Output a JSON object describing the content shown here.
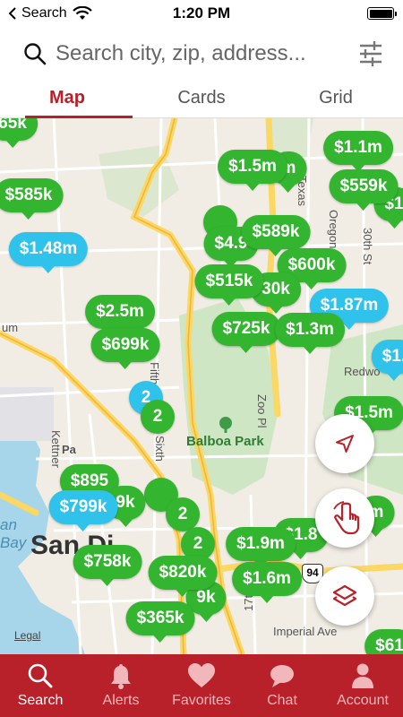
{
  "status_bar": {
    "back_app": "Search",
    "time": "1:20 PM"
  },
  "search": {
    "placeholder": "Search city, zip, address..."
  },
  "tabs": [
    {
      "label": "Map",
      "active": true
    },
    {
      "label": "Cards",
      "active": false
    },
    {
      "label": "Grid",
      "active": false
    }
  ],
  "map": {
    "labels": {
      "park": "Balboa Park",
      "imperial": "Imperial Ave",
      "kettner": "Kettner",
      "fifth": "Fifth",
      "sixth": "Sixth",
      "zoo": "Zoo Pl",
      "oregon": "Oregon",
      "thirtieth": "30th St",
      "texas": "Texas",
      "redwood": "Redwo",
      "seventeenth": "17th",
      "um": "um",
      "pa": "Pa",
      "sd": "San Di",
      "an": "an",
      "bay": "Bay",
      "highway": "94"
    },
    "legal": "Legal",
    "pins": [
      {
        "label": "65k",
        "color": "green"
      },
      {
        "label": "$1.1m",
        "color": "green"
      },
      {
        "label": "$1.5m",
        "color": "green"
      },
      {
        "label": "m",
        "color": "green"
      },
      {
        "label": "$585k",
        "color": "green"
      },
      {
        "label": "$559k",
        "color": "green"
      },
      {
        "label": "$1",
        "color": "green"
      },
      {
        "label": "$4.9",
        "color": "green"
      },
      {
        "label": "$589k",
        "color": "green"
      },
      {
        "label": "$1.48m",
        "color": "blue"
      },
      {
        "label": "$600k",
        "color": "green"
      },
      {
        "label": "$515k",
        "color": "green"
      },
      {
        "label": "30k",
        "color": "green"
      },
      {
        "label": "$1.87m",
        "color": "blue"
      },
      {
        "label": "$2.5m",
        "color": "green"
      },
      {
        "label": "$725k",
        "color": "green"
      },
      {
        "label": "$1.3m",
        "color": "green"
      },
      {
        "label": "$699k",
        "color": "green"
      },
      {
        "label": "$1.",
        "color": "blue"
      },
      {
        "label": "$1.5m",
        "color": "green"
      },
      {
        "label": "$895",
        "color": "green"
      },
      {
        "label": "9k",
        "color": "green"
      },
      {
        "label": "$799k",
        "color": "blue"
      },
      {
        "label": "$1.9m",
        "color": "green"
      },
      {
        "label": "$1.8",
        "color": "green"
      },
      {
        "label": "m",
        "color": "green"
      },
      {
        "label": "$758k",
        "color": "green"
      },
      {
        "label": "$820k",
        "color": "green"
      },
      {
        "label": "$1.6m",
        "color": "green"
      },
      {
        "label": "9k",
        "color": "green"
      },
      {
        "label": "$365k",
        "color": "green"
      },
      {
        "label": "$61",
        "color": "green"
      }
    ],
    "clusters": [
      {
        "label": "2",
        "color": "blue"
      },
      {
        "label": "2",
        "color": "green"
      },
      {
        "label": "2",
        "color": "green"
      },
      {
        "label": "2",
        "color": "green"
      }
    ]
  },
  "bottom_nav": [
    {
      "label": "Search",
      "icon": "search-icon",
      "active": true
    },
    {
      "label": "Alerts",
      "icon": "bell-icon",
      "active": false
    },
    {
      "label": "Favorites",
      "icon": "heart-icon",
      "active": false
    },
    {
      "label": "Chat",
      "icon": "chat-icon",
      "active": false
    },
    {
      "label": "Account",
      "icon": "person-icon",
      "active": false
    }
  ],
  "colors": {
    "brand": "#b8202a",
    "pin_green": "#33b52f",
    "pin_blue": "#2fc2ea",
    "map_bg": "#f1ede4",
    "park": "#cfe6c4",
    "water": "#a7d5ea",
    "road": "#fbd763"
  }
}
